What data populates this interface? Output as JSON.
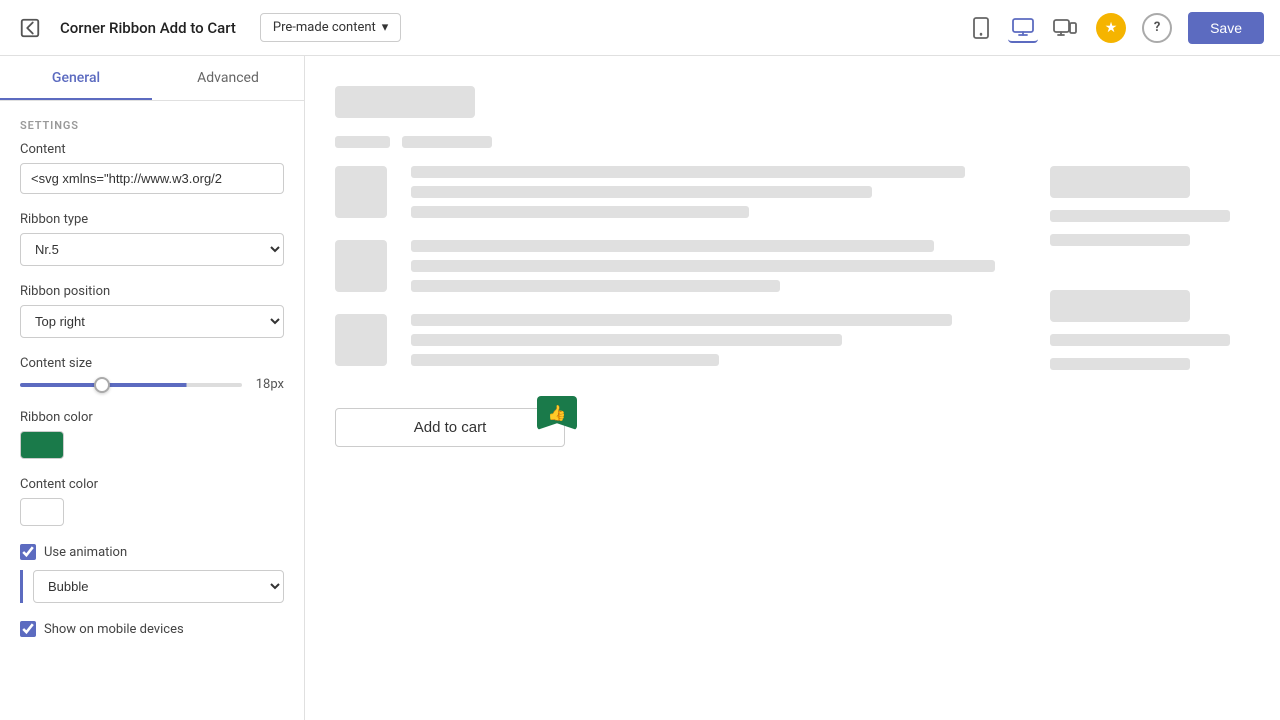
{
  "topbar": {
    "title": "Corner Ribbon Add to Cart",
    "dropdown_label": "Pre-made content",
    "save_label": "Save"
  },
  "tabs": {
    "general": "General",
    "advanced": "Advanced"
  },
  "sidebar": {
    "section_label": "SETTINGS",
    "content_label": "Content",
    "content_value": "<svg xmlns=\"http://www.w3.org/2",
    "content_placeholder": "<svg xmlns=\"http://www.w3.org/2",
    "ribbon_type_label": "Ribbon type",
    "ribbon_type_value": "Nr.5",
    "ribbon_position_label": "Ribbon position",
    "ribbon_position_value": "Top right",
    "content_size_label": "Content size",
    "content_size_value": "18px",
    "ribbon_color_label": "Ribbon color",
    "content_color_label": "Content color",
    "use_animation_label": "Use animation",
    "animation_type_value": "Bubble",
    "show_mobile_label": "Show on mobile devices"
  },
  "canvas": {
    "add_to_cart_label": "Add to cart"
  },
  "icons": {
    "back": "⬅",
    "star": "★",
    "help": "?",
    "mobile": "📱",
    "desktop": "🖥",
    "responsive": "⇔",
    "chevron": "▾",
    "thumbs_up": "👍"
  },
  "colors": {
    "ribbon": "#1a7a4a",
    "content_color": "#ffffff",
    "accent": "#5c6bc0",
    "star": "#f5b400"
  }
}
